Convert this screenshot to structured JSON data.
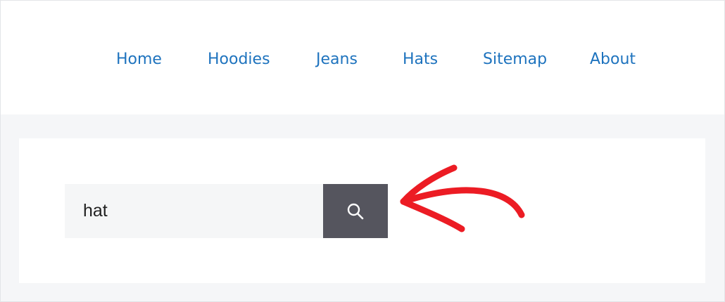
{
  "nav": {
    "items": [
      {
        "label": "Home"
      },
      {
        "label": "Hoodies"
      },
      {
        "label": "Jeans"
      },
      {
        "label": "Hats"
      },
      {
        "label": "Sitemap"
      },
      {
        "label": "About"
      }
    ]
  },
  "search": {
    "value": "hat",
    "icon": "search-icon"
  },
  "annotation": {
    "icon": "red-arrow-pointing-left",
    "color": "#ec1c24"
  },
  "colors": {
    "link": "#1e73be",
    "button_bg": "#55555e",
    "page_bg": "#f5f6f8",
    "input_bg": "#f5f6f7"
  }
}
